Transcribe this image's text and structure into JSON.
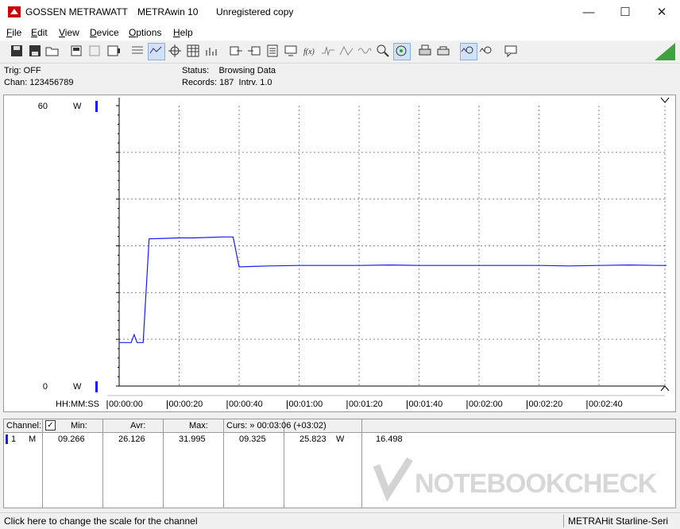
{
  "window": {
    "brand": "GOSSEN METRAWATT",
    "app": "METRAwin 10",
    "license": "Unregistered copy"
  },
  "menu": [
    {
      "u": "F",
      "rest": "ile"
    },
    {
      "u": "E",
      "rest": "dit"
    },
    {
      "u": "V",
      "rest": "iew"
    },
    {
      "u": "D",
      "rest": "evice"
    },
    {
      "u": "O",
      "rest": "ptions"
    },
    {
      "u": "H",
      "rest": "elp"
    }
  ],
  "info": {
    "trig": "Trig: OFF",
    "chan": "Chan:  123456789",
    "status": "Status:    Browsing Data",
    "records": "Records: 187  Intrv. 1.0"
  },
  "chart_data": {
    "type": "line",
    "series": [
      {
        "x": [
          0,
          2,
          4,
          5,
          6,
          8,
          10,
          15,
          20,
          25,
          30,
          35,
          38,
          40,
          45,
          50,
          60,
          70,
          80,
          90,
          100,
          110,
          120,
          130,
          140,
          150,
          160,
          170,
          180,
          183,
          186
        ],
        "y": [
          9.3,
          9.3,
          9.3,
          11.0,
          9.3,
          9.3,
          31.5,
          31.6,
          31.7,
          31.7,
          31.8,
          31.9,
          31.9,
          25.5,
          25.6,
          25.7,
          25.8,
          25.8,
          25.8,
          25.9,
          25.8,
          25.8,
          25.8,
          25.8,
          25.8,
          25.7,
          25.8,
          25.9,
          25.8,
          25.8,
          25.8
        ],
        "color": "#1a1aff"
      }
    ],
    "xlabel": "HH:MM:SS",
    "xticks": [
      {
        "t": 0,
        "label": "00:00:00"
      },
      {
        "t": 20,
        "label": "00:00:20"
      },
      {
        "t": 40,
        "label": "00:00:40"
      },
      {
        "t": 60,
        "label": "00:01:00"
      },
      {
        "t": 80,
        "label": "00:01:20"
      },
      {
        "t": 100,
        "label": "00:01:40"
      },
      {
        "t": 120,
        "label": "00:02:00"
      },
      {
        "t": 140,
        "label": "00:02:20"
      },
      {
        "t": 160,
        "label": "00:02:40"
      }
    ],
    "xlim": [
      0,
      182
    ],
    "ylim": [
      0,
      60
    ],
    "y_top_label": "60",
    "y_bottom_label": "0",
    "unit": "W",
    "grid": true,
    "gridline_count_y": 6,
    "dashed_grid": true
  },
  "table": {
    "headers": {
      "channel": "Channel:",
      "min": "Min:",
      "avr": "Avr:",
      "max": "Max:",
      "curs": "Curs: » 00:03:06 (+03:02)"
    },
    "row": {
      "num": "1",
      "mode": "M",
      "min": "09.266",
      "avr": "26.126",
      "max": "31.995",
      "c1": "09.325",
      "c2": "25.823",
      "unit": "W",
      "c3": "16.498"
    }
  },
  "status": {
    "left": "Click here to change the scale for the channel",
    "right": "METRAHit Starline-Seri"
  },
  "watermark": "NOTEBOOKCHECK"
}
